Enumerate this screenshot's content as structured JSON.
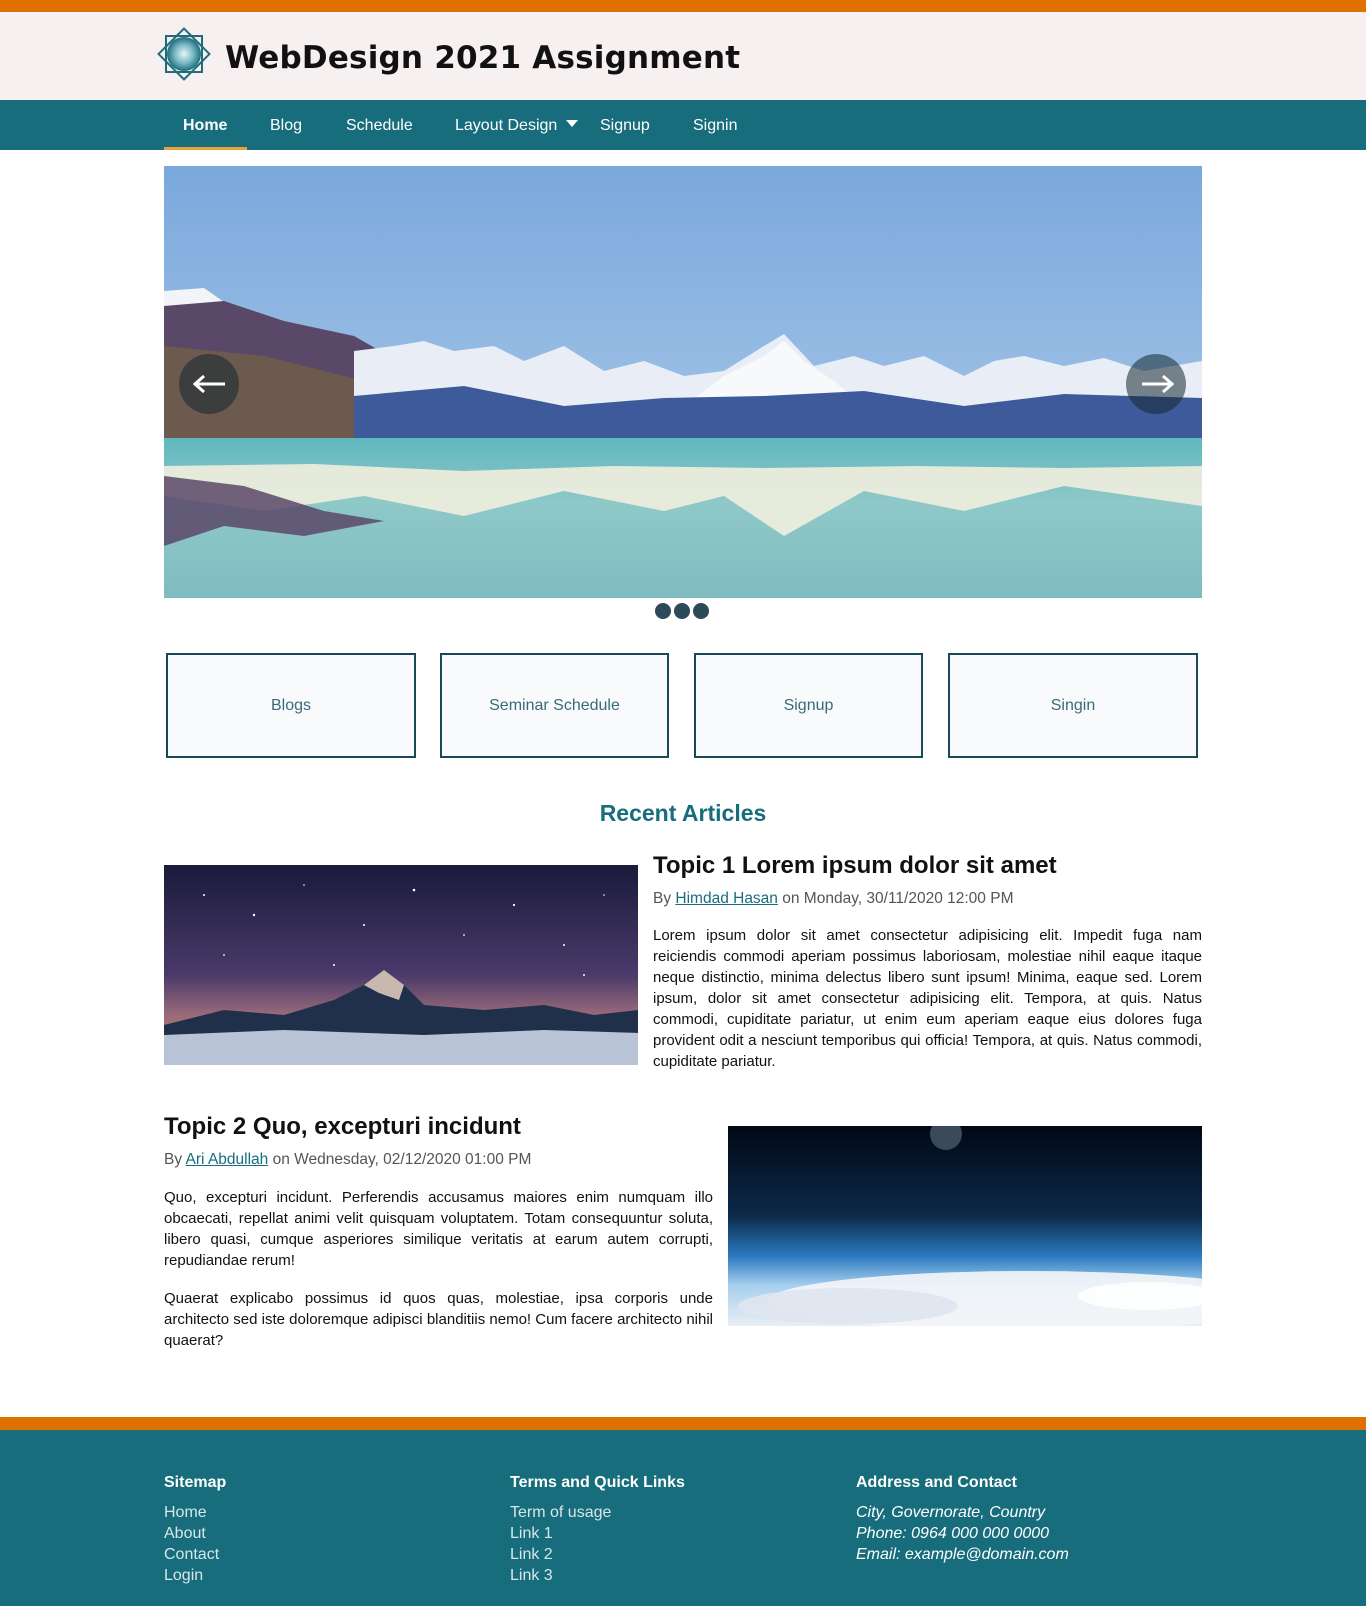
{
  "header": {
    "title": "WebDesign 2021 Assignment",
    "logo": "diamond-logo-icon"
  },
  "nav": {
    "items": [
      {
        "label": "Home",
        "active": true
      },
      {
        "label": "Blog"
      },
      {
        "label": "Schedule"
      },
      {
        "label": "Layout Design",
        "has_dropdown": true
      },
      {
        "label": "Signup"
      },
      {
        "label": "Signin"
      }
    ]
  },
  "carousel": {
    "slides": 3,
    "prev_icon": "arrow-left-icon",
    "next_icon": "arrow-right-icon"
  },
  "tiles": [
    "Blogs",
    "Seminar Schedule",
    "Signup",
    "Singin"
  ],
  "recent": {
    "title": "Recent Articles",
    "articles": [
      {
        "title": "Topic 1 Lorem ipsum dolor sit amet",
        "by": "By",
        "author": "Himdad Hasan",
        "date": "on Monday, 30/11/2020 12:00 PM",
        "paragraphs": [
          "Lorem ipsum dolor sit amet consectetur adipisicing elit. Impedit fuga nam reiciendis commodi aperiam possimus laboriosam, molestiae nihil eaque itaque neque distinctio, minima delectus libero sunt ipsum! Minima, eaque sed. Lorem ipsum, dolor sit amet consectetur adipisicing elit. Tempora, at quis. Natus commodi, cupiditate pariatur, ut enim eum aperiam eaque eius dolores fuga provident odit a nesciunt temporibus qui officia! Tempora, at quis. Natus commodi, cupiditate pariatur."
        ]
      },
      {
        "title": "Topic 2 Quo, excepturi incidunt",
        "by": "By",
        "author": "Ari Abdullah",
        "date": "on Wednesday, 02/12/2020 01:00 PM",
        "paragraphs": [
          "Quo, excepturi incidunt. Perferendis accusamus maiores enim numquam illo obcaecati, repellat animi velit quisquam voluptatem. Totam consequuntur soluta, libero quasi, cumque asperiores similique veritatis at earum autem corrupti, repudiandae rerum!",
          "Quaerat explicabo possimus id quos quas, molestiae, ipsa corporis unde architecto sed iste doloremque adipisci blanditiis nemo! Cum facere architecto nihil quaerat?"
        ]
      }
    ]
  },
  "footer": {
    "sitemap": {
      "heading": "Sitemap",
      "links": [
        "Home",
        "About",
        "Contact",
        "Login"
      ]
    },
    "terms": {
      "heading": "Terms and Quick Links",
      "links": [
        "Term of usage",
        "Link 1",
        "Link 2",
        "Link 3"
      ]
    },
    "contact": {
      "heading": "Address and Contact",
      "lines": [
        "City, Governorate, Country",
        "Phone: 0964 000 000 0000",
        "Email: example@domain.com"
      ]
    }
  },
  "colors": {
    "accent": "#e07000",
    "primary": "#176d7c",
    "underline": "#e8a33a"
  }
}
